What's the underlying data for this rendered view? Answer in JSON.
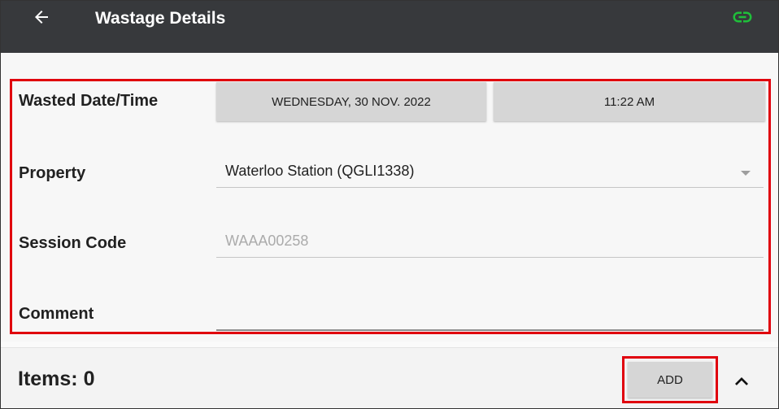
{
  "header": {
    "title": "Wastage Details",
    "back_icon": "arrow-left-icon",
    "link_icon": "link-icon",
    "link_color": "#1fbf3a"
  },
  "form": {
    "wasted_datetime": {
      "label": "Wasted Date/Time",
      "date_value": "WEDNESDAY, 30 NOV. 2022",
      "time_value": "11:22 AM"
    },
    "property": {
      "label": "Property",
      "selected_value": "Waterloo Station (QGLI1338)"
    },
    "session_code": {
      "label": "Session Code",
      "value": "WAAA00258"
    },
    "comment": {
      "label": "Comment",
      "value": ""
    }
  },
  "items": {
    "label": "Items: 0",
    "add_label": "ADD",
    "collapse_icon": "chevron-up-icon"
  },
  "colors": {
    "appbar": "#37393c",
    "highlight": "#e0000d",
    "button": "#d6d6d6"
  }
}
